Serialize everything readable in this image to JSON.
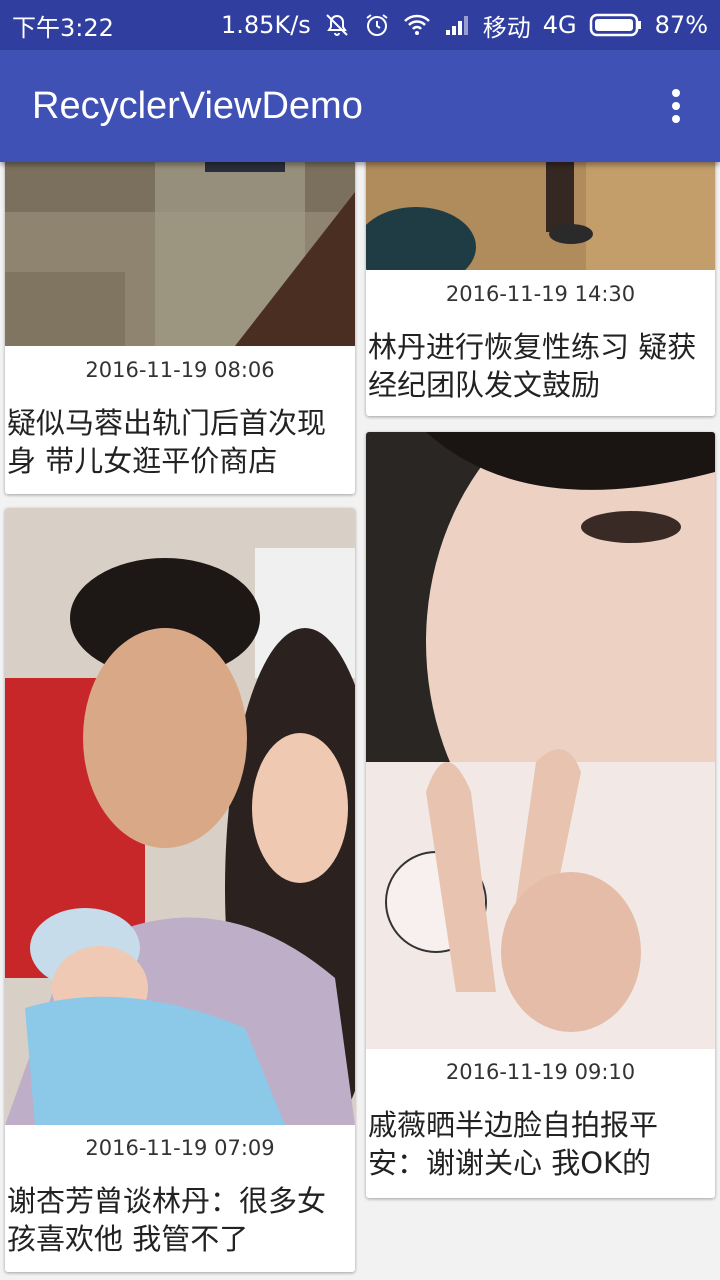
{
  "status_bar": {
    "time": "下午3:22",
    "speed": "1.85K/s",
    "carrier": "移动",
    "network": "4G",
    "battery": "87%",
    "icons": [
      "mute-icon",
      "alarm-icon",
      "wifi-icon",
      "signal-icon",
      "battery-icon"
    ]
  },
  "app_bar": {
    "title": "RecyclerViewDemo",
    "menu_icon": "more-vert-icon",
    "color": "#3f51b5",
    "status_color": "#303f9f"
  },
  "feed": {
    "items": [
      {
        "date": "2016-11-19 08:06",
        "caption": "疑似马蓉出轨门后首次现身 带儿女逛平价商店"
      },
      {
        "date": "2016-11-19 14:30",
        "caption": "林丹进行恢复性练习 疑获经纪团队发文鼓励"
      },
      {
        "date": "2016-11-19 07:09",
        "caption": "谢杏芳曾谈林丹：很多女孩喜欢他 我管不了"
      },
      {
        "date": "2016-11-19 09:10",
        "caption": "戚薇晒半边脸自拍报平安：谢谢关心 我OK的"
      }
    ]
  }
}
